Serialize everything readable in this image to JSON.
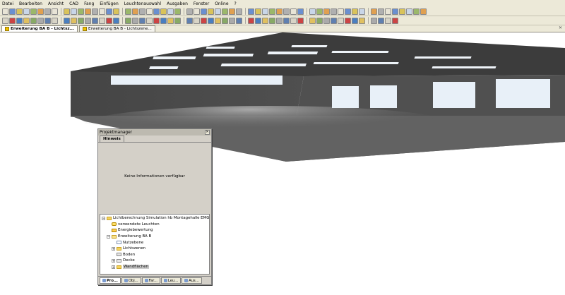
{
  "menu": {
    "items": [
      {
        "label": "Datei"
      },
      {
        "label": "Bearbeiten"
      },
      {
        "label": "Ansicht"
      },
      {
        "label": "CAD"
      },
      {
        "label": "Fang"
      },
      {
        "label": "Einfügen"
      },
      {
        "label": "Leuchtenauswahl"
      },
      {
        "label": "Ausgaben"
      },
      {
        "label": "Fenster"
      },
      {
        "label": "Online"
      },
      {
        "label": "?"
      }
    ]
  },
  "doc_tabs": [
    {
      "label": "Erweiterung BA B - Lichtsz..."
    },
    {
      "label": "Erweiterung BA B - Lichtszene..."
    }
  ],
  "project_manager": {
    "title": "Projektmanager",
    "tab_label": "Hinweis",
    "info_text": "Keine Informationen verfügbar",
    "tree": [
      {
        "label": "Lichtberechnung Simulation hb Montagehalle EMG Automat",
        "level": 0,
        "expander": "−",
        "icon": "folder"
      },
      {
        "label": "verwendete Leuchten",
        "level": 1,
        "expander": "",
        "icon": "lamp"
      },
      {
        "label": "Energiebewertung",
        "level": 1,
        "expander": "",
        "icon": "energy"
      },
      {
        "label": "Erweiterung BA B",
        "level": 1,
        "expander": "−",
        "icon": "folder-open"
      },
      {
        "label": "Nutzebene",
        "level": 2,
        "expander": "",
        "icon": "doc"
      },
      {
        "label": "Lichtszenen",
        "level": 2,
        "expander": "+",
        "icon": "folder"
      },
      {
        "label": "Boden",
        "level": 2,
        "expander": "",
        "icon": "grey"
      },
      {
        "label": "Decke",
        "level": 2,
        "expander": "+",
        "icon": "grey"
      },
      {
        "label": "Wandflächen",
        "level": 2,
        "expander": "+",
        "icon": "folder",
        "selected": true
      }
    ],
    "bottom_tabs": [
      {
        "label": "Pro...",
        "active": true
      },
      {
        "label": "Obj..."
      },
      {
        "label": "Far..."
      },
      {
        "label": "Leu..."
      },
      {
        "label": "Aus..."
      }
    ]
  },
  "colors": {
    "chrome": "#ece9d8",
    "panel": "#d4d0c8",
    "hall_wall": "#4a4a4a",
    "hall_ceiling": "#3a3a3a",
    "window_light": "#e8f0f8"
  }
}
